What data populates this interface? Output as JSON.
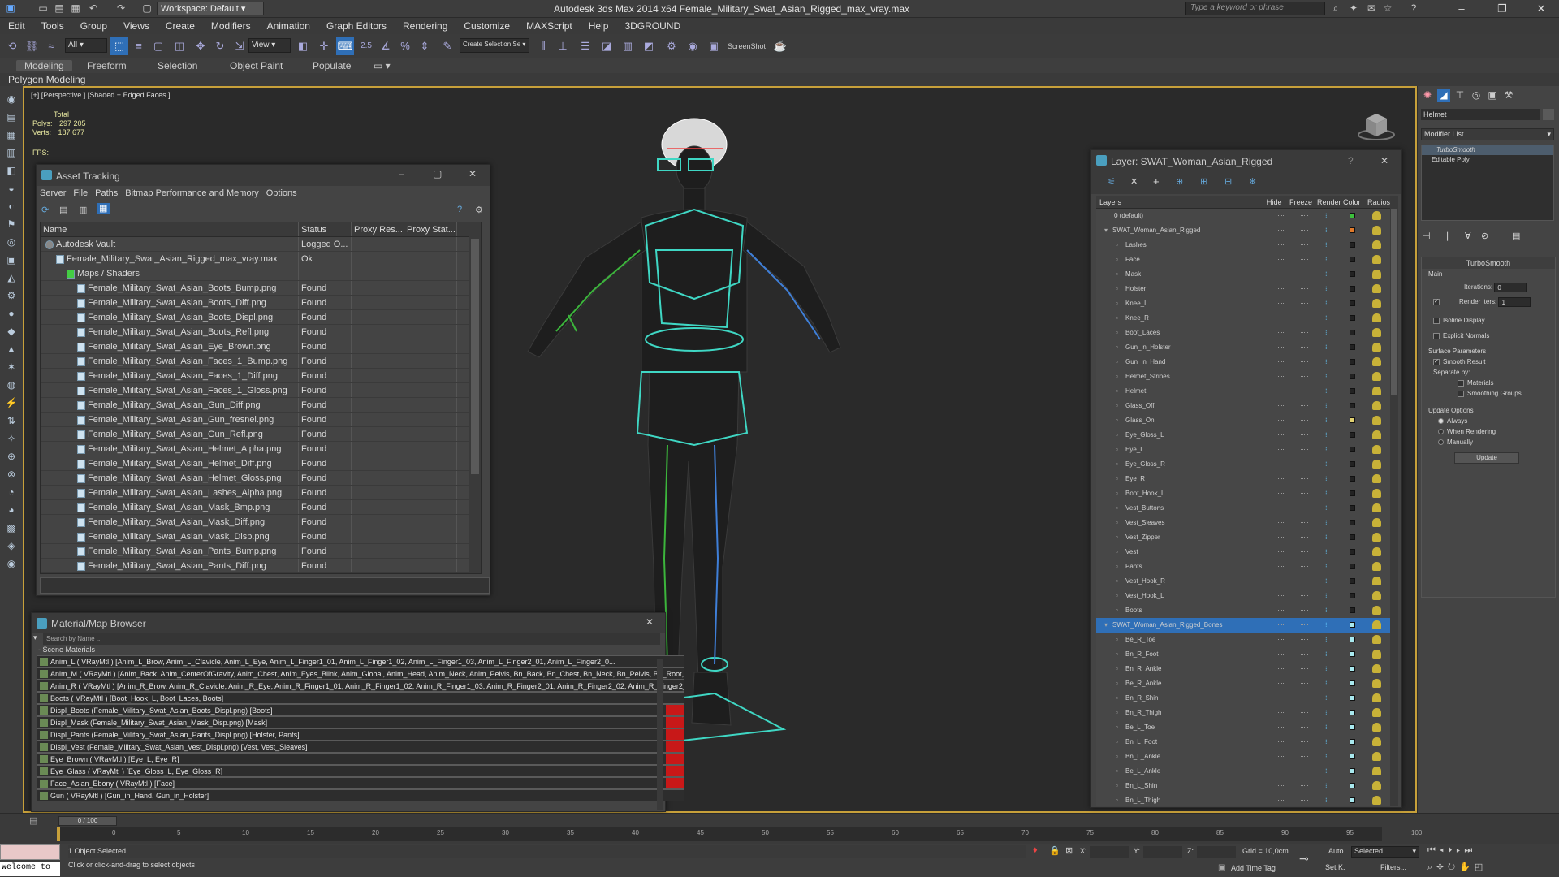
{
  "app": {
    "title": "Autodesk 3ds Max  2014 x64       Female_Military_Swat_Asian_Rigged_max_vray.max",
    "workspace": "Workspace: Default",
    "search_placeholder": "Type a keyword or phrase"
  },
  "menu": [
    "Edit",
    "Tools",
    "Group",
    "Views",
    "Create",
    "Modifiers",
    "Animation",
    "Graph Editors",
    "Rendering",
    "Customize",
    "MAXScript",
    "Help",
    "3DGROUND"
  ],
  "toolbar": {
    "filter": "All",
    "refcoord": "View",
    "snap_label": "2.5",
    "named_sel": "Create Selection Se",
    "screenshot": "ScreenShot"
  },
  "ribbon": {
    "tabs": [
      "Modeling",
      "Freeform",
      "Selection",
      "Object Paint",
      "Populate"
    ],
    "panel": "Polygon Modeling"
  },
  "viewport": {
    "label": "[+] [Perspective ] [Shaded + Edged Faces ]",
    "stats_total": "Total",
    "polys_label": "Polys:",
    "polys": "297 205",
    "verts_label": "Verts:",
    "verts": "187 677",
    "fps_label": "FPS:"
  },
  "asset_tracking": {
    "title": "Asset Tracking",
    "menu": [
      "Server",
      "File",
      "Paths",
      "Bitmap Performance and Memory",
      "Options"
    ],
    "columns": [
      "Name",
      "Status",
      "Proxy Res...",
      "Proxy Stat..."
    ],
    "rows": [
      {
        "name": "Autodesk Vault",
        "status": "Logged O...",
        "level": 0
      },
      {
        "name": "Female_Military_Swat_Asian_Rigged_max_vray.max",
        "status": "Ok",
        "level": 1
      },
      {
        "name": "Maps / Shaders",
        "status": "",
        "level": 2
      },
      {
        "name": "Female_Military_Swat_Asian_Boots_Bump.png",
        "status": "Found",
        "level": 3
      },
      {
        "name": "Female_Military_Swat_Asian_Boots_Diff.png",
        "status": "Found",
        "level": 3
      },
      {
        "name": "Female_Military_Swat_Asian_Boots_Displ.png",
        "status": "Found",
        "level": 3
      },
      {
        "name": "Female_Military_Swat_Asian_Boots_Refl.png",
        "status": "Found",
        "level": 3
      },
      {
        "name": "Female_Military_Swat_Asian_Eye_Brown.png",
        "status": "Found",
        "level": 3
      },
      {
        "name": "Female_Military_Swat_Asian_Faces_1_Bump.png",
        "status": "Found",
        "level": 3
      },
      {
        "name": "Female_Military_Swat_Asian_Faces_1_Diff.png",
        "status": "Found",
        "level": 3
      },
      {
        "name": "Female_Military_Swat_Asian_Faces_1_Gloss.png",
        "status": "Found",
        "level": 3
      },
      {
        "name": "Female_Military_Swat_Asian_Gun_Diff.png",
        "status": "Found",
        "level": 3
      },
      {
        "name": "Female_Military_Swat_Asian_Gun_fresnel.png",
        "status": "Found",
        "level": 3
      },
      {
        "name": "Female_Military_Swat_Asian_Gun_Refl.png",
        "status": "Found",
        "level": 3
      },
      {
        "name": "Female_Military_Swat_Asian_Helmet_Alpha.png",
        "status": "Found",
        "level": 3
      },
      {
        "name": "Female_Military_Swat_Asian_Helmet_Diff.png",
        "status": "Found",
        "level": 3
      },
      {
        "name": "Female_Military_Swat_Asian_Helmet_Gloss.png",
        "status": "Found",
        "level": 3
      },
      {
        "name": "Female_Military_Swat_Asian_Lashes_Alpha.png",
        "status": "Found",
        "level": 3
      },
      {
        "name": "Female_Military_Swat_Asian_Mask_Bmp.png",
        "status": "Found",
        "level": 3
      },
      {
        "name": "Female_Military_Swat_Asian_Mask_Diff.png",
        "status": "Found",
        "level": 3
      },
      {
        "name": "Female_Military_Swat_Asian_Mask_Disp.png",
        "status": "Found",
        "level": 3
      },
      {
        "name": "Female_Military_Swat_Asian_Pants_Bump.png",
        "status": "Found",
        "level": 3
      },
      {
        "name": "Female_Military_Swat_Asian_Pants_Diff.png",
        "status": "Found",
        "level": 3
      }
    ]
  },
  "material_browser": {
    "title": "Material/Map Browser",
    "search_placeholder": "Search by Name ...",
    "section": "- Scene Materials",
    "rows": [
      {
        "text": "Anim_L  ( VRayMtl ) [Anim_L_Brow, Anim_L_Clavicle, Anim_L_Eye, Anim_L_Finger1_01, Anim_L_Finger1_02, Anim_L_Finger1_03, Anim_L_Finger2_01, Anim_L_Finger2_0...",
        "red": false
      },
      {
        "text": "Anim_M  ( VRayMtl ) [Anim_Back, Anim_CenterOfGravity, Anim_Chest, Anim_Eyes_Blink, Anim_Global, Anim_Head, Anim_Neck, Anim_Pelvis, Bn_Back, Bn_Chest, Bn_Neck, Bn_Pelvis, Bn_Root,...",
        "red": false
      },
      {
        "text": "Anim_R  ( VRayMtl ) [Anim_R_Brow, Anim_R_Clavicle, Anim_R_Eye, Anim_R_Finger1_01, Anim_R_Finger1_02, Anim_R_Finger1_03, Anim_R_Finger2_01, Anim_R_Finger2_02, Anim_R_Finger2_0...",
        "red": false
      },
      {
        "text": "Boots  ( VRayMtl ) [Boot_Hook_L, Boot_Laces, Boots]",
        "red": false
      },
      {
        "text": "Displ_Boots (Female_Military_Swat_Asian_Boots_Displ.png) [Boots]",
        "red": true
      },
      {
        "text": "Displ_Mask (Female_Military_Swat_Asian_Mask_Disp.png) [Mask]",
        "red": true
      },
      {
        "text": "Displ_Pants (Female_Military_Swat_Asian_Pants_Displ.png) [Holster, Pants]",
        "red": true
      },
      {
        "text": "Displ_Vest (Female_Military_Swat_Asian_Vest_Displ.png) [Vest, Vest_Sleaves]",
        "red": true
      },
      {
        "text": "Eye_Brown  ( VRayMtl ) [Eye_L, Eye_R]",
        "red": true
      },
      {
        "text": "Eye_Glass  ( VRayMtl ) [Eye_Gloss_L, Eye_Gloss_R]",
        "red": true
      },
      {
        "text": "Face_Asian_Ebony  ( VRayMtl ) [Face]",
        "red": true
      },
      {
        "text": "Gun  ( VRayMtl ) [Gun_in_Hand, Gun_in_Holster]",
        "red": false
      }
    ]
  },
  "layer_explorer": {
    "title": "Layer: SWAT_Woman_Asian_Rigged",
    "columns": [
      "Layers",
      "Hide",
      "Freeze",
      "Render",
      "Color",
      "Radios"
    ],
    "rows": [
      {
        "name": "0 (default)",
        "level": 1,
        "color": "#3cbf3c"
      },
      {
        "name": "SWAT_Woman_Asian_Rigged",
        "level": 0,
        "color": "#e07a2a"
      },
      {
        "name": "Lashes",
        "level": 2,
        "color": "#222222"
      },
      {
        "name": "Face",
        "level": 2,
        "color": "#222222"
      },
      {
        "name": "Mask",
        "level": 2,
        "color": "#222222"
      },
      {
        "name": "Holster",
        "level": 2,
        "color": "#222222"
      },
      {
        "name": "Knee_L",
        "level": 2,
        "color": "#222222"
      },
      {
        "name": "Knee_R",
        "level": 2,
        "color": "#222222"
      },
      {
        "name": "Boot_Laces",
        "level": 2,
        "color": "#222222"
      },
      {
        "name": "Gun_in_Holster",
        "level": 2,
        "color": "#222222"
      },
      {
        "name": "Gun_in_Hand",
        "level": 2,
        "color": "#222222"
      },
      {
        "name": "Helmet_Stripes",
        "level": 2,
        "color": "#222222"
      },
      {
        "name": "Helmet",
        "level": 2,
        "color": "#222222"
      },
      {
        "name": "Glass_Off",
        "level": 2,
        "color": "#222222"
      },
      {
        "name": "Glass_On",
        "level": 2,
        "color": "#e0d070"
      },
      {
        "name": "Eye_Gloss_L",
        "level": 2,
        "color": "#222222"
      },
      {
        "name": "Eye_L",
        "level": 2,
        "color": "#222222"
      },
      {
        "name": "Eye_Gloss_R",
        "level": 2,
        "color": "#222222"
      },
      {
        "name": "Eye_R",
        "level": 2,
        "color": "#222222"
      },
      {
        "name": "Boot_Hook_L",
        "level": 2,
        "color": "#222222"
      },
      {
        "name": "Vest_Buttons",
        "level": 2,
        "color": "#222222"
      },
      {
        "name": "Vest_Sleaves",
        "level": 2,
        "color": "#222222"
      },
      {
        "name": "Vest_Zipper",
        "level": 2,
        "color": "#222222"
      },
      {
        "name": "Vest",
        "level": 2,
        "color": "#222222"
      },
      {
        "name": "Pants",
        "level": 2,
        "color": "#222222"
      },
      {
        "name": "Vest_Hook_R",
        "level": 2,
        "color": "#222222"
      },
      {
        "name": "Vest_Hook_L",
        "level": 2,
        "color": "#222222"
      },
      {
        "name": "Boots",
        "level": 2,
        "color": "#222222"
      },
      {
        "name": "SWAT_Woman_Asian_Rigged_Bones",
        "level": 0,
        "color": "#a8e8ee",
        "selected": true
      },
      {
        "name": "Be_R_Toe",
        "level": 2,
        "color": "#a8e8ee"
      },
      {
        "name": "Bn_R_Foot",
        "level": 2,
        "color": "#a8e8ee"
      },
      {
        "name": "Bn_R_Ankle",
        "level": 2,
        "color": "#a8e8ee"
      },
      {
        "name": "Be_R_Ankle",
        "level": 2,
        "color": "#a8e8ee"
      },
      {
        "name": "Bn_R_Shin",
        "level": 2,
        "color": "#a8e8ee"
      },
      {
        "name": "Bn_R_Thigh",
        "level": 2,
        "color": "#a8e8ee"
      },
      {
        "name": "Be_L_Toe",
        "level": 2,
        "color": "#a8e8ee"
      },
      {
        "name": "Bn_L_Foot",
        "level": 2,
        "color": "#a8e8ee"
      },
      {
        "name": "Bn_L_Ankle",
        "level": 2,
        "color": "#a8e8ee"
      },
      {
        "name": "Be_L_Ankle",
        "level": 2,
        "color": "#a8e8ee"
      },
      {
        "name": "Bn_L_Shin",
        "level": 2,
        "color": "#a8e8ee"
      },
      {
        "name": "Bn_L_Thigh",
        "level": 2,
        "color": "#a8e8ee"
      }
    ]
  },
  "command_panel": {
    "object_name": "Helmet",
    "modifier_list": "Modifier List",
    "stack": [
      "TurboSmooth",
      "Editable Poly"
    ],
    "turbosmooth": {
      "title": "TurboSmooth",
      "main": "Main",
      "iterations_label": "Iterations:",
      "iterations": "0",
      "render_iters_label": "Render Iters:",
      "render_iters": "1",
      "isoline": "Isoline Display",
      "explicit": "Explicit Normals",
      "surface": "Surface Parameters",
      "smooth_result": "Smooth Result",
      "separate_by": "Separate by:",
      "materials": "Materials",
      "smoothing_groups": "Smoothing Groups",
      "update_options": "Update Options",
      "always": "Always",
      "when_rendering": "When Rendering",
      "manually": "Manually",
      "update_btn": "Update"
    }
  },
  "timeline": {
    "range": "0 / 100",
    "ticks": [
      "0",
      "5",
      "10",
      "15",
      "20",
      "25",
      "30",
      "35",
      "40",
      "45",
      "50",
      "55",
      "60",
      "65",
      "70",
      "75",
      "80",
      "85",
      "90",
      "95",
      "100"
    ]
  },
  "status": {
    "welcome": "Welcome to",
    "selected": "1 Object Selected",
    "prompt": "Click or click-and-drag to select objects",
    "x_label": "X:",
    "y_label": "Y:",
    "z_label": "Z:",
    "grid": "Grid = 10,0cm",
    "add_time_tag": "Add Time Tag",
    "auto": "Auto",
    "set_k": "Set K.",
    "selected_dd": "Selected",
    "filters": "Filters..."
  }
}
